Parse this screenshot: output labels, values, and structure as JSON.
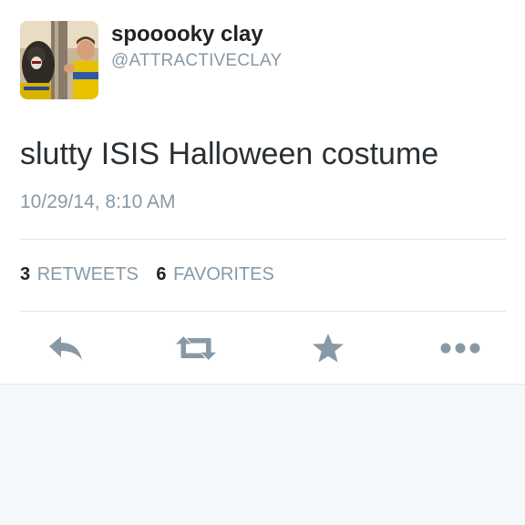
{
  "tweet": {
    "display_name": "spooooky clay",
    "handle": "@ATTRACTIVECLAY",
    "text": "slutty ISIS Halloween costume",
    "timestamp": "10/29/14, 8:10 AM",
    "retweets_count": "3",
    "retweets_label": "RETWEETS",
    "favorites_count": "6",
    "favorites_label": "FAVORITES"
  },
  "actions": {
    "reply_icon": "reply-icon",
    "retweet_icon": "retweet-icon",
    "favorite_icon": "star-icon",
    "more_icon": "more-dots-icon"
  },
  "colors": {
    "accent_gray": "#8899a6",
    "icon_gray": "#8899a6",
    "text": "#292f33",
    "background_lower": "#f5f8fa"
  }
}
